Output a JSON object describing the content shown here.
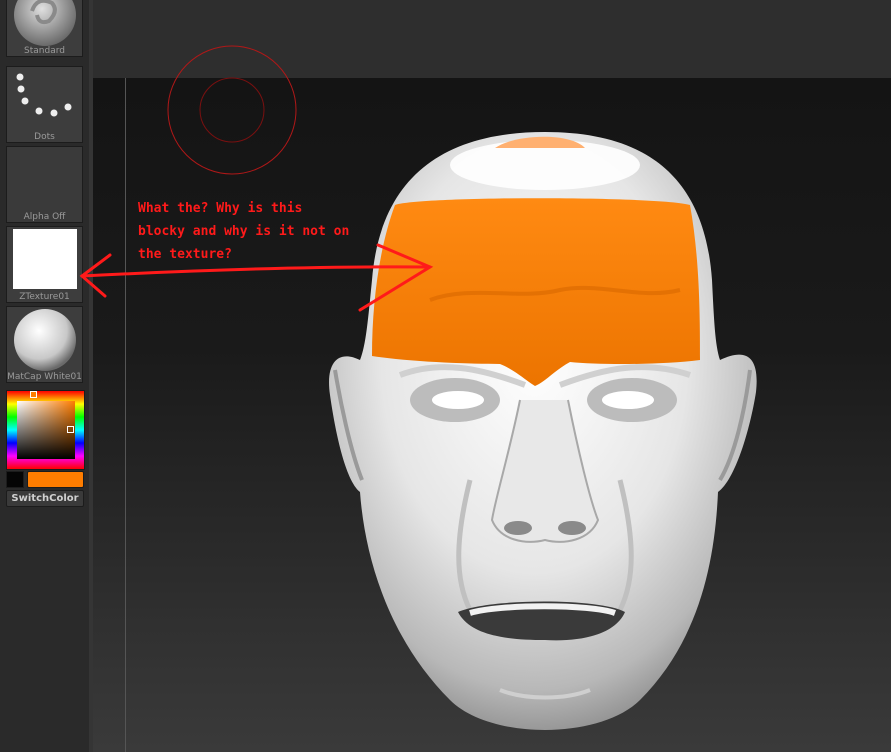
{
  "left_panel": {
    "brush": {
      "label": "Standard",
      "icon": "standard-brush-icon"
    },
    "stroke": {
      "label": "Dots",
      "icon": "dots-stroke-icon"
    },
    "alpha": {
      "label": "Alpha  Off"
    },
    "texture": {
      "label": "ZTexture01",
      "preview_color": "#ffffff"
    },
    "material": {
      "label": "MatCap  White01"
    },
    "color_picker": {
      "main_color": "#050505",
      "secondary_color": "#ff7d00"
    },
    "switch_color_label": "SwitchColor"
  },
  "canvas": {
    "annotation": "What the? Why is this\nblocky and why is it not on\nthe texture?",
    "annotation_color": "#ff1a1a",
    "paint_color": "#ff7d00"
  }
}
